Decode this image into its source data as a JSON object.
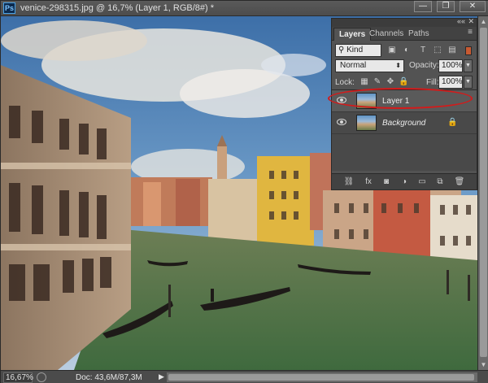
{
  "window": {
    "app_badge": "Ps",
    "title": "venice-298315.jpg @ 16,7% (Layer 1, RGB/8#) *",
    "minimize": "—",
    "maximize": "❐",
    "close": "✕"
  },
  "status_bar": {
    "zoom": "16,67%",
    "doc_info": "Doc: 43,6M/87,3M",
    "arrow": "▶"
  },
  "layers_panel": {
    "collapse": "««",
    "close": "✕",
    "menu": "≡",
    "tabs": [
      {
        "label": "Layers",
        "active": true
      },
      {
        "label": "Channels",
        "active": false
      },
      {
        "label": "Paths",
        "active": false
      }
    ],
    "filter": {
      "kind_label": "Kind",
      "icons": [
        "image-filter-icon",
        "adjustment-filter-icon",
        "type-filter-icon",
        "shape-filter-icon",
        "smart-object-filter-icon"
      ]
    },
    "blend_mode": "Normal",
    "opacity_label": "Opacity:",
    "opacity_value": "100%",
    "lock_label": "Lock:",
    "fill_label": "Fill:",
    "fill_value": "100%",
    "layers": [
      {
        "name": "Layer 1",
        "selected": true,
        "locked": false,
        "italic": false
      },
      {
        "name": "Background",
        "selected": false,
        "locked": true,
        "italic": true
      }
    ],
    "highlight_color": "#d41a1a"
  }
}
